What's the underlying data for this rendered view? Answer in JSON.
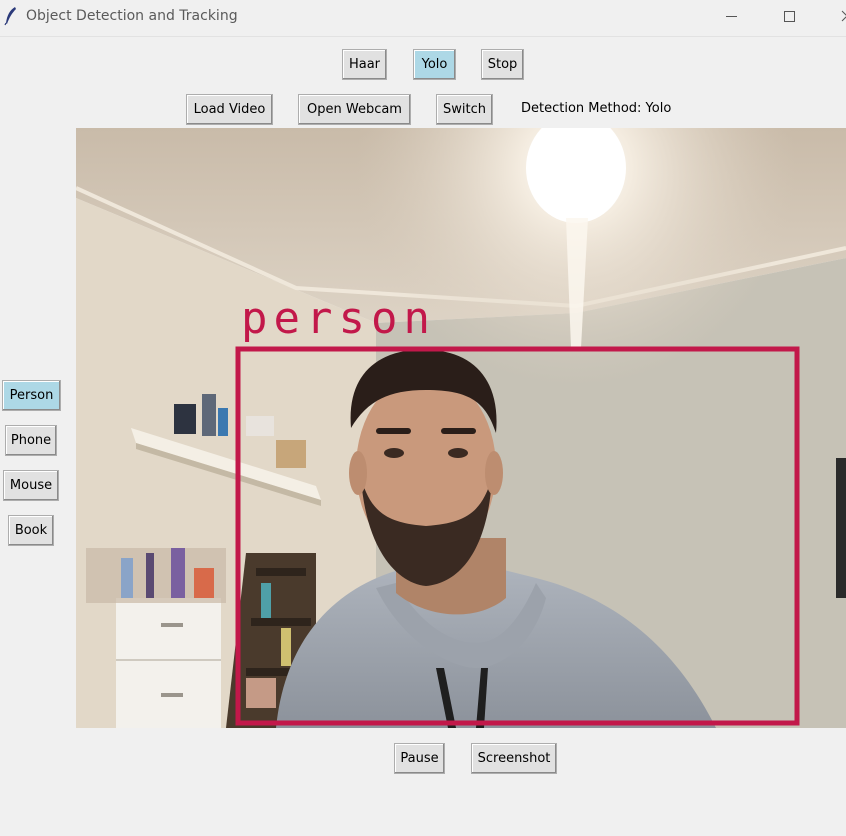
{
  "window": {
    "title": "Object Detection and Tracking",
    "icon": "feather-icon",
    "controls": [
      "minimize-icon",
      "maximize-icon",
      "close-icon"
    ]
  },
  "toolbar_top": {
    "haar_label": "Haar",
    "yolo_label": "Yolo",
    "stop_label": "Stop",
    "active": "Yolo"
  },
  "toolbar_second": {
    "load_video_label": "Load Video",
    "open_webcam_label": "Open Webcam",
    "switch_label": "Switch",
    "detection_method_text": "Detection Method: Yolo"
  },
  "sidebar": {
    "items": [
      {
        "label": "Person",
        "active": true
      },
      {
        "label": "Phone",
        "active": false
      },
      {
        "label": "Mouse",
        "active": false
      },
      {
        "label": "Book",
        "active": false
      }
    ]
  },
  "video": {
    "detection_label": "person",
    "box_color": "#c2184a"
  },
  "bottom": {
    "pause_label": "Pause",
    "screenshot_label": "Screenshot"
  },
  "colors": {
    "window_bg": "#f0f0f0",
    "button_bg": "#e1e1e1",
    "active_button_bg": "#add8e6"
  }
}
